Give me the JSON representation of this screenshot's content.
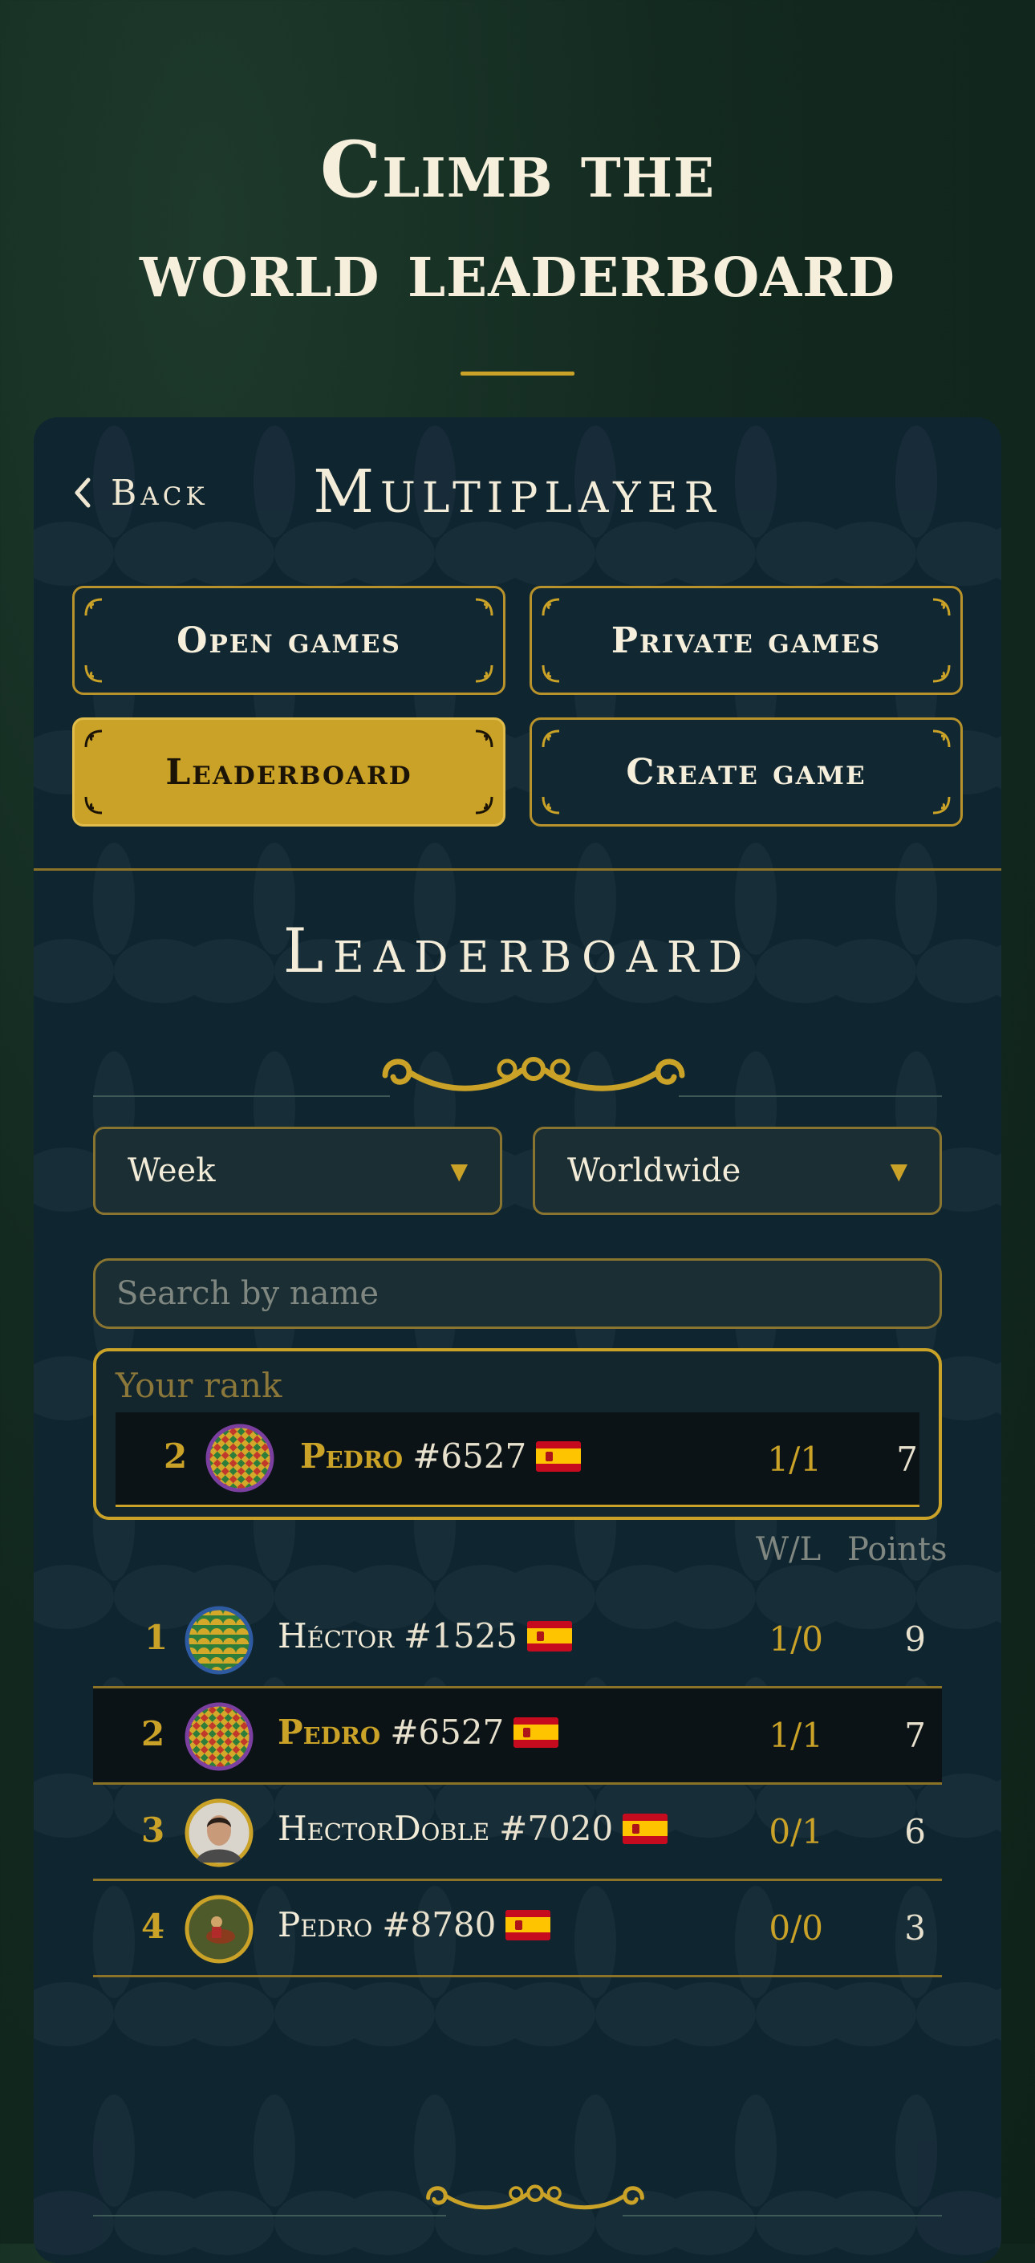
{
  "hero": {
    "title_line1": "Climb the",
    "title_line2": "world leaderboard"
  },
  "nav": {
    "back_label": "Back",
    "title": "Multiplayer"
  },
  "tabs": [
    {
      "label": "Open games",
      "active": false
    },
    {
      "label": "Private games",
      "active": false
    },
    {
      "label": "Leaderboard",
      "active": true
    },
    {
      "label": "Create game",
      "active": false
    }
  ],
  "leaderboard": {
    "title": "Leaderboard",
    "period_select": {
      "value": "Week"
    },
    "region_select": {
      "value": "Worldwide"
    },
    "search": {
      "placeholder": "Search by name",
      "value": ""
    },
    "your_rank": {
      "label": "Your rank",
      "rank": "2",
      "name": "Pedro",
      "tag": "#6527",
      "flag": "spain-flag-icon",
      "wl": "1/1",
      "points": "7"
    },
    "columns": {
      "wl": "W/L",
      "points": "Points"
    },
    "rows": [
      {
        "rank": "1",
        "name": "Héctor",
        "tag": "#1525",
        "flag": "spain-flag-icon",
        "wl": "1/0",
        "points": "9",
        "is_me": false
      },
      {
        "rank": "2",
        "name": "Pedro",
        "tag": "#6527",
        "flag": "spain-flag-icon",
        "wl": "1/1",
        "points": "7",
        "is_me": true
      },
      {
        "rank": "3",
        "name": "HectorDoble",
        "tag": "#7020",
        "flag": "spain-flag-icon",
        "wl": "0/1",
        "points": "6",
        "is_me": false
      },
      {
        "rank": "4",
        "name": "Pedro",
        "tag": "#8780",
        "flag": "spain-flag-icon",
        "wl": "0/0",
        "points": "3",
        "is_me": false
      }
    ]
  },
  "colors": {
    "accent": "#c9a227",
    "panel": "#0f2530",
    "background": "#132a20",
    "text": "#f3ecd8"
  },
  "icons": [
    "chevron-left-icon",
    "corner-flourish-icon",
    "ornament-scroll-icon",
    "dropdown-caret-icon",
    "spain-flag-icon"
  ]
}
